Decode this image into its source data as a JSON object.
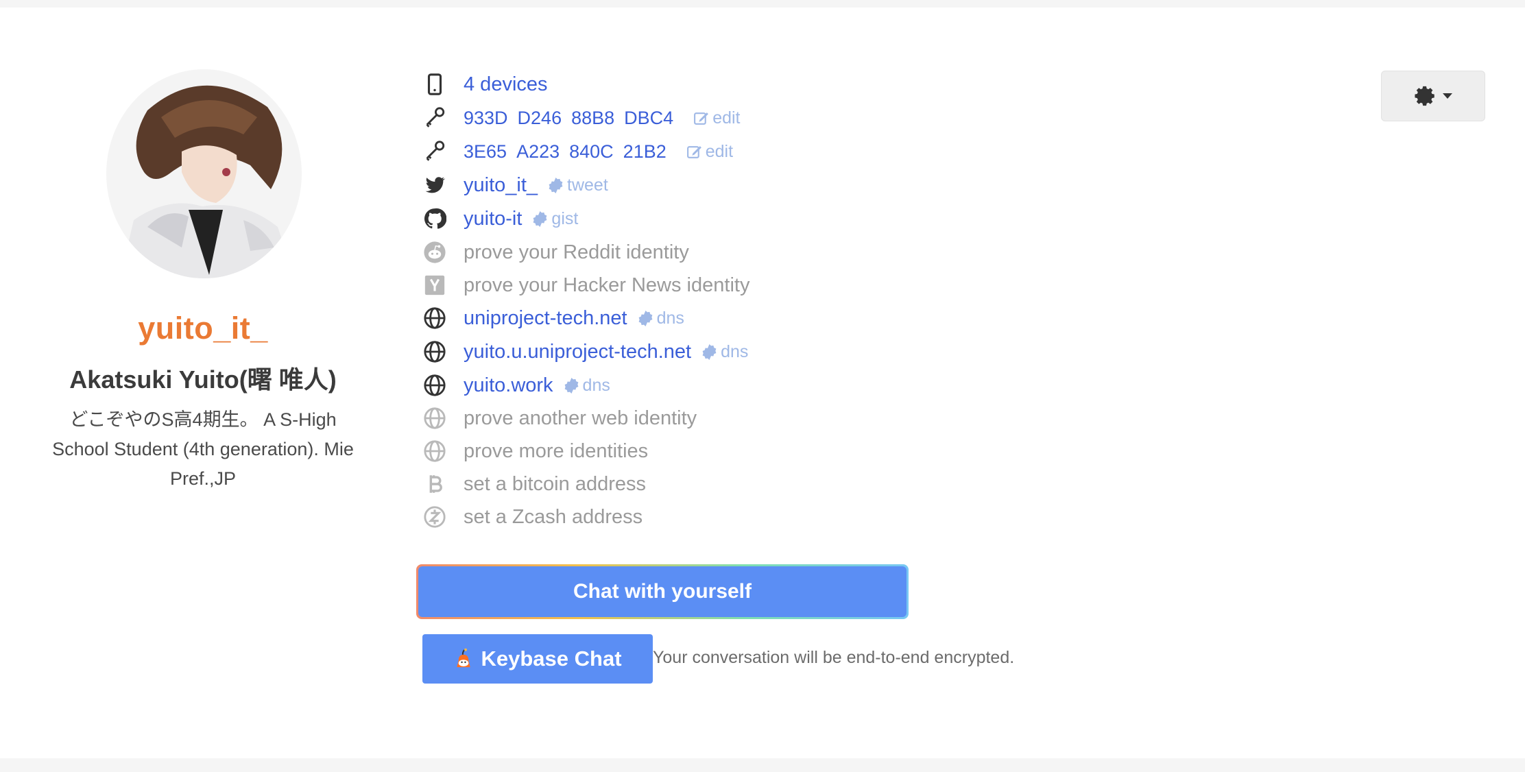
{
  "profile": {
    "username": "yuito_it_",
    "full_name": "Akatsuki Yuito(曙 唯人)",
    "bio": "どこぞやのS高4期生。 A S-High School Student (4th generation). Mie Pref.,JP"
  },
  "proofs": {
    "devices": "4 devices",
    "key1": {
      "segments": [
        "933D",
        "D246",
        "88B8",
        "DBC4"
      ],
      "action": "edit"
    },
    "key2": {
      "segments": [
        "3E65",
        "A223",
        "840C",
        "21B2"
      ],
      "action": "edit"
    },
    "twitter": {
      "handle": "yuito_it_",
      "proof": "tweet"
    },
    "github": {
      "handle": "yuito-it",
      "proof": "gist"
    },
    "reddit": "prove your Reddit identity",
    "hackernews": "prove your Hacker News identity",
    "web1": {
      "domain": "uniproject-tech.net",
      "proof": "dns"
    },
    "web2": {
      "domain": "yuito.u.uniproject-tech.net",
      "proof": "dns"
    },
    "web3": {
      "domain": "yuito.work",
      "proof": "dns"
    },
    "another_web": "prove another web identity",
    "more": "prove more identities",
    "bitcoin": "set a bitcoin address",
    "zcash": "set a Zcash address"
  },
  "actions": {
    "chat_self": "Chat with yourself",
    "keybase_chat": "Keybase Chat",
    "encrypted_note": "Your conversation will be end-to-end encrypted."
  },
  "colors": {
    "username": "#ea7a34",
    "link": "#3a5ed8",
    "button": "#5b8ef4"
  }
}
